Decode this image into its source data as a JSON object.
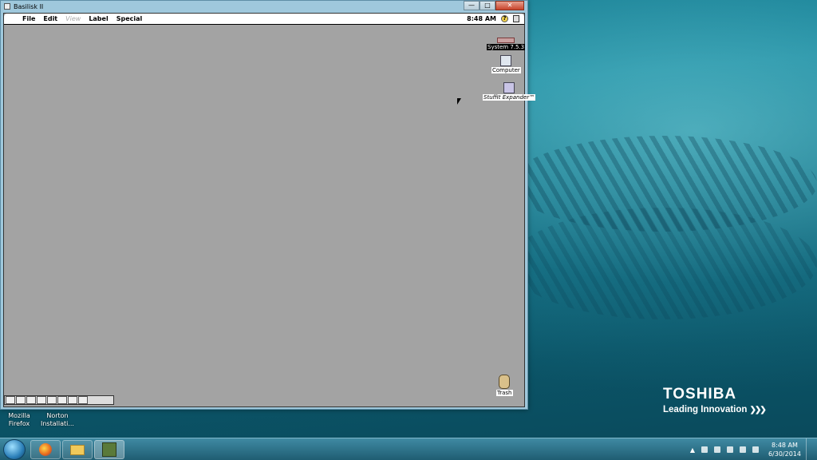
{
  "window": {
    "title": "Basilisk II",
    "controls": {
      "minimize": "—",
      "maximize": "□",
      "close": "✕"
    }
  },
  "mac": {
    "menu": [
      "File",
      "Edit",
      "View",
      "Label",
      "Special"
    ],
    "clock": "8:48 AM",
    "icons": {
      "system": "System 7.5.3",
      "computer": "Computer",
      "stuffit": "StuffIt Expander™",
      "trash": "Trash"
    }
  },
  "desktop": {
    "icons": [
      {
        "label1": "Mozilla",
        "label2": "Firefox"
      },
      {
        "label1": "Norton",
        "label2": "Installati..."
      }
    ],
    "brand": "TOSHIBA",
    "tagline": "Leading Innovation"
  },
  "taskbar": {
    "time": "8:48 AM",
    "date": "6/30/2014"
  },
  "colors": {
    "mac_desktop": "#a3a3a3",
    "win_desktop": "#1a7f93",
    "taskbar": "#2f7590"
  }
}
